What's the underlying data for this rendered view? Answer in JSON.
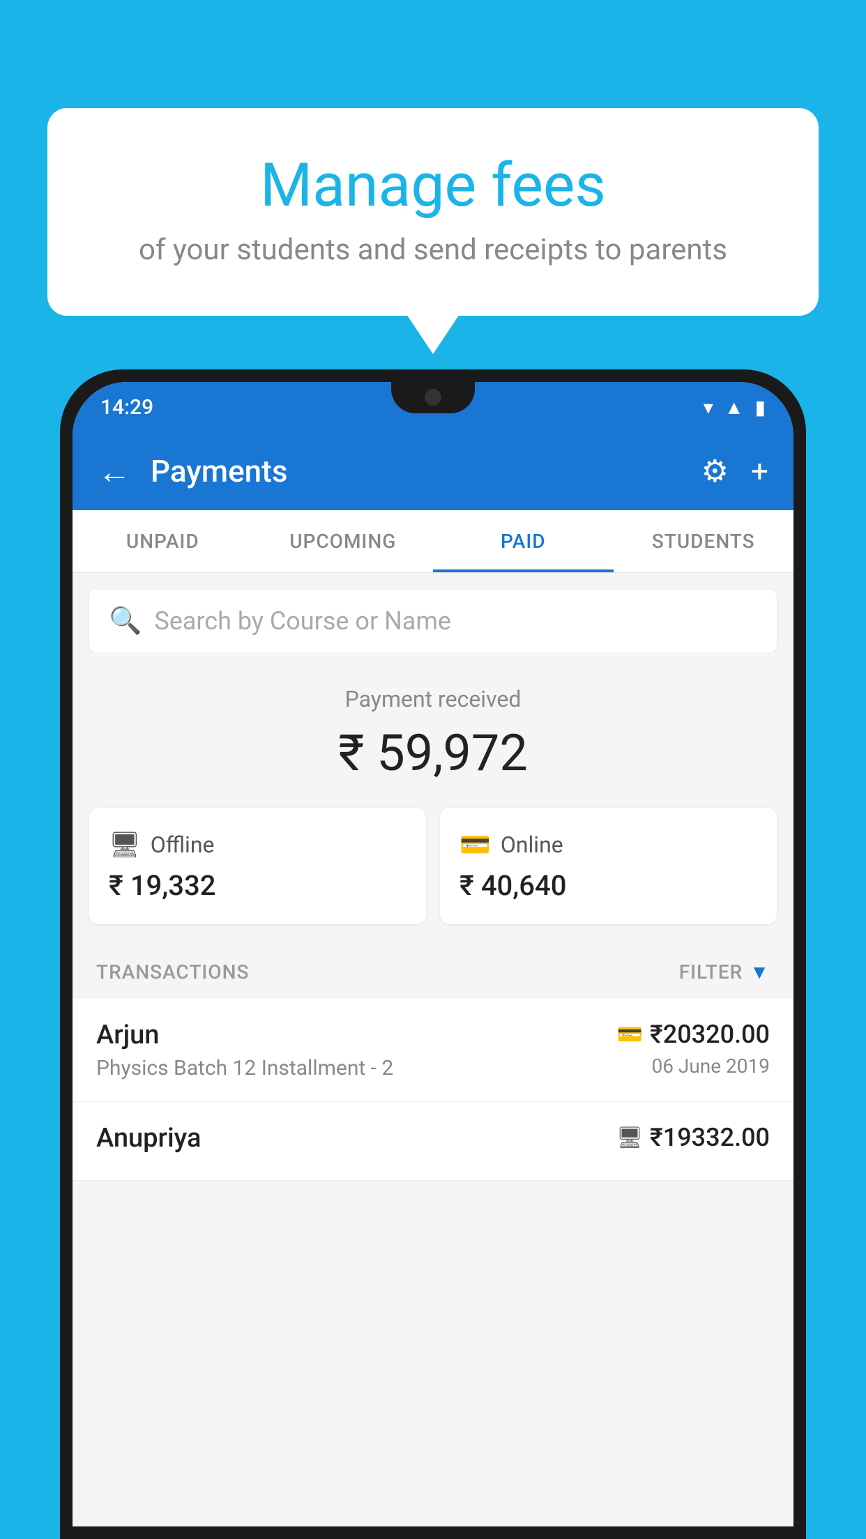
{
  "background_color": "#1ab4e8",
  "bubble": {
    "title": "Manage fees",
    "subtitle": "of your students and send receipts to parents"
  },
  "status_bar": {
    "time": "14:29"
  },
  "app_bar": {
    "title": "Payments",
    "back_icon": "←",
    "settings_icon": "⚙",
    "add_icon": "+"
  },
  "tabs": [
    {
      "label": "UNPAID",
      "active": false
    },
    {
      "label": "UPCOMING",
      "active": false
    },
    {
      "label": "PAID",
      "active": true
    },
    {
      "label": "STUDENTS",
      "active": false
    }
  ],
  "search": {
    "placeholder": "Search by Course or Name"
  },
  "payment_summary": {
    "label": "Payment received",
    "amount": "₹ 59,972",
    "offline": {
      "icon": "💳",
      "label": "Offline",
      "amount": "₹ 19,332"
    },
    "online": {
      "icon": "💳",
      "label": "Online",
      "amount": "₹ 40,640"
    }
  },
  "transactions": {
    "label": "TRANSACTIONS",
    "filter_label": "FILTER",
    "items": [
      {
        "name": "Arjun",
        "course": "Physics Batch 12 Installment - 2",
        "amount": "₹20320.00",
        "date": "06 June 2019",
        "payment_type": "online"
      },
      {
        "name": "Anupriya",
        "course": "",
        "amount": "₹19332.00",
        "date": "",
        "payment_type": "offline"
      }
    ]
  }
}
